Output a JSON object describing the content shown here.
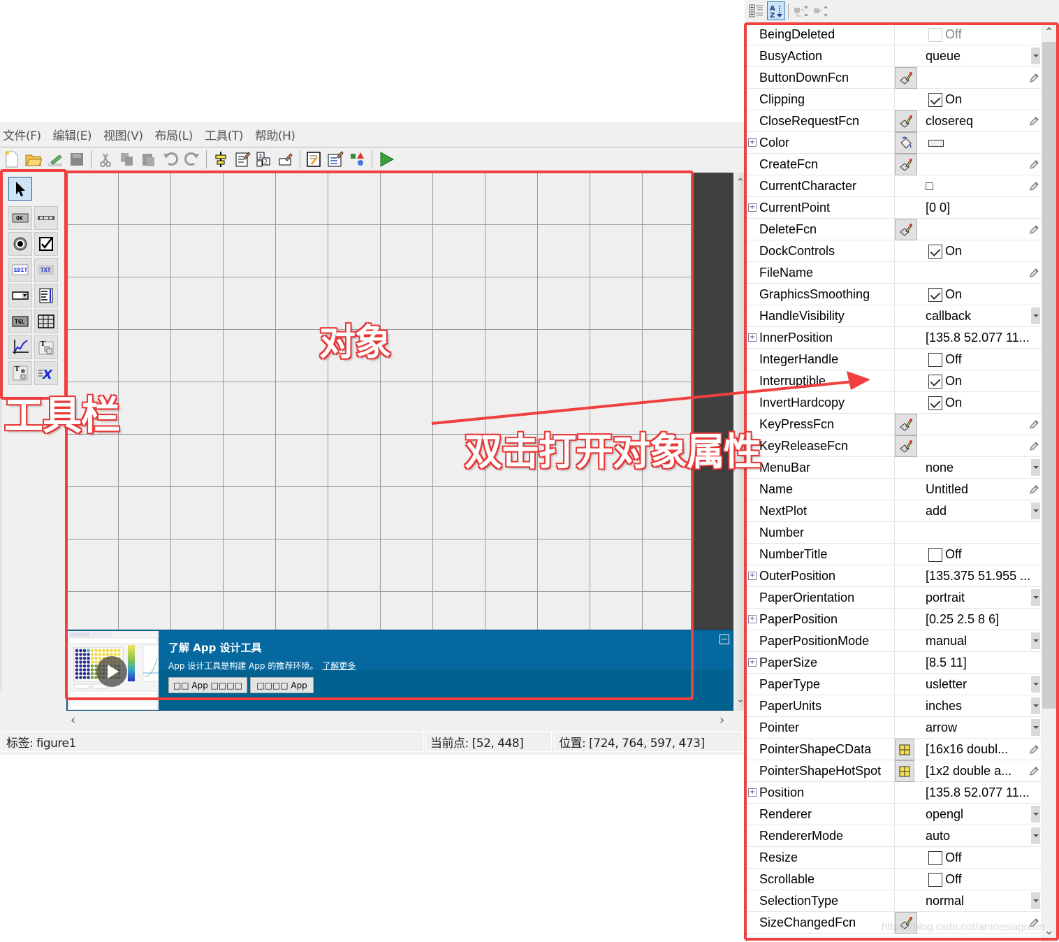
{
  "guide": {
    "menu": [
      "文件(F)",
      "编辑(E)",
      "视图(V)",
      "布局(L)",
      "工具(T)",
      "帮助(H)"
    ],
    "toolbar": [
      {
        "icon": "new-figure-icon"
      },
      {
        "icon": "open-file-icon"
      },
      {
        "icon": "export-icon"
      },
      {
        "icon": "save-icon"
      },
      {
        "sep": true
      },
      {
        "icon": "cut-icon"
      },
      {
        "icon": "copy-icon"
      },
      {
        "icon": "paste-icon"
      },
      {
        "icon": "undo-icon"
      },
      {
        "icon": "redo-icon"
      },
      {
        "sep": true
      },
      {
        "icon": "align-objects-icon"
      },
      {
        "icon": "menu-editor-icon"
      },
      {
        "icon": "tab-order-editor-icon"
      },
      {
        "icon": "toolbar-editor-icon"
      },
      {
        "sep": true
      },
      {
        "icon": "editor-icon"
      },
      {
        "icon": "property-inspector-icon"
      },
      {
        "icon": "object-browser-icon"
      },
      {
        "sep": true
      },
      {
        "icon": "run-figure-icon"
      }
    ],
    "palette": [
      {
        "name": "select-tool",
        "glyph": "arrow"
      },
      {
        "name": "push-button-tool",
        "glyph": "OK"
      },
      {
        "name": "slider-tool",
        "glyph": "slider"
      },
      {
        "name": "radio-button-tool",
        "glyph": "radio"
      },
      {
        "name": "checkbox-tool",
        "glyph": "check"
      },
      {
        "name": "edit-text-tool",
        "glyph": "EDIT"
      },
      {
        "name": "static-text-tool",
        "glyph": "TXT"
      },
      {
        "name": "popup-menu-tool",
        "glyph": "popup"
      },
      {
        "name": "listbox-tool",
        "glyph": "list"
      },
      {
        "name": "toggle-button-tool",
        "glyph": "TGL"
      },
      {
        "name": "table-tool",
        "glyph": "table"
      },
      {
        "name": "axes-tool",
        "glyph": "axes"
      },
      {
        "name": "panel-tool",
        "glyph": "panel"
      },
      {
        "name": "button-group-tool",
        "glyph": "bgroup"
      },
      {
        "name": "activex-tool",
        "glyph": "activex"
      }
    ],
    "banner": {
      "title": "了解 App 设计工具",
      "desc": "App 设计工具是构建 App 的推荐环境。",
      "link": "了解更多",
      "btn1": "□□ App □□□□",
      "btn2": "□□□□ App"
    },
    "status": {
      "tag": "标签: figure1",
      "current_point": "当前点:  [52, 448]",
      "position": "位置: [724, 764, 597, 473]"
    }
  },
  "inspector": {
    "toolbar": [
      "categorized-view",
      "alphabetical-view",
      "expand-all",
      "collapse-all"
    ],
    "properties": [
      {
        "name": "BeingDeleted",
        "type": "check",
        "checked": false,
        "value": "Off",
        "dim": true
      },
      {
        "name": "BusyAction",
        "type": "enum",
        "value": "queue"
      },
      {
        "name": "ButtonDownFcn",
        "type": "callback",
        "value": ""
      },
      {
        "name": "Clipping",
        "type": "check",
        "checked": true,
        "value": "On"
      },
      {
        "name": "CloseRequestFcn",
        "type": "callback",
        "value": "closereq"
      },
      {
        "name": "Color",
        "type": "color",
        "expand": true,
        "value": ""
      },
      {
        "name": "CreateFcn",
        "type": "callback",
        "value": ""
      },
      {
        "name": "CurrentCharacter",
        "type": "text",
        "value": "□",
        "pencil": true
      },
      {
        "name": "CurrentPoint",
        "type": "text",
        "expand": true,
        "value": "[0 0]"
      },
      {
        "name": "DeleteFcn",
        "type": "callback",
        "value": ""
      },
      {
        "name": "DockControls",
        "type": "check",
        "checked": true,
        "value": "On"
      },
      {
        "name": "FileName",
        "type": "text",
        "value": "",
        "pencil": true
      },
      {
        "name": "GraphicsSmoothing",
        "type": "check",
        "checked": true,
        "value": "On"
      },
      {
        "name": "HandleVisibility",
        "type": "enum",
        "value": "callback"
      },
      {
        "name": "InnerPosition",
        "type": "text",
        "expand": true,
        "value": "[135.8 52.077 11..."
      },
      {
        "name": "IntegerHandle",
        "type": "check",
        "checked": false,
        "value": "Off"
      },
      {
        "name": "Interruptible",
        "type": "check",
        "checked": true,
        "value": "On"
      },
      {
        "name": "InvertHardcopy",
        "type": "check",
        "checked": true,
        "value": "On"
      },
      {
        "name": "KeyPressFcn",
        "type": "callback",
        "value": ""
      },
      {
        "name": "KeyReleaseFcn",
        "type": "callback",
        "value": ""
      },
      {
        "name": "MenuBar",
        "type": "enum",
        "value": "none"
      },
      {
        "name": "Name",
        "type": "text",
        "value": "Untitled",
        "pencil": true
      },
      {
        "name": "NextPlot",
        "type": "enum",
        "value": "add"
      },
      {
        "name": "Number",
        "type": "text",
        "value": ""
      },
      {
        "name": "NumberTitle",
        "type": "check",
        "checked": false,
        "value": "Off"
      },
      {
        "name": "OuterPosition",
        "type": "text",
        "expand": true,
        "value": "[135.375 51.955 ..."
      },
      {
        "name": "PaperOrientation",
        "type": "enum",
        "value": "portrait"
      },
      {
        "name": "PaperPosition",
        "type": "text",
        "expand": true,
        "value": "[0.25 2.5 8 6]"
      },
      {
        "name": "PaperPositionMode",
        "type": "enum",
        "value": "manual"
      },
      {
        "name": "PaperSize",
        "type": "text",
        "expand": true,
        "value": "[8.5 11]"
      },
      {
        "name": "PaperType",
        "type": "enum",
        "value": "usletter"
      },
      {
        "name": "PaperUnits",
        "type": "enum",
        "value": "inches"
      },
      {
        "name": "Pointer",
        "type": "enum",
        "value": "arrow"
      },
      {
        "name": "PointerShapeCData",
        "type": "matrix",
        "value": "[16x16  doubl...",
        "pencil": true
      },
      {
        "name": "PointerShapeHotSpot",
        "type": "matrix",
        "value": "[1x2  double a...",
        "pencil": true
      },
      {
        "name": "Position",
        "type": "text",
        "expand": true,
        "value": "[135.8 52.077 11..."
      },
      {
        "name": "Renderer",
        "type": "enum",
        "value": "opengl"
      },
      {
        "name": "RendererMode",
        "type": "enum",
        "value": "auto"
      },
      {
        "name": "Resize",
        "type": "check",
        "checked": false,
        "value": "Off"
      },
      {
        "name": "Scrollable",
        "type": "check",
        "checked": false,
        "value": "Off"
      },
      {
        "name": "SelectionType",
        "type": "enum",
        "value": "normal"
      },
      {
        "name": "SizeChangedFcn",
        "type": "callback",
        "value": ""
      }
    ]
  },
  "annotations": {
    "palette_label": "工具栏",
    "object_label": "对象",
    "arrow_label": "双击打开对象属性",
    "color": "#f04040"
  },
  "watermark": "https://blog.csdn.net/amnesiagreen"
}
